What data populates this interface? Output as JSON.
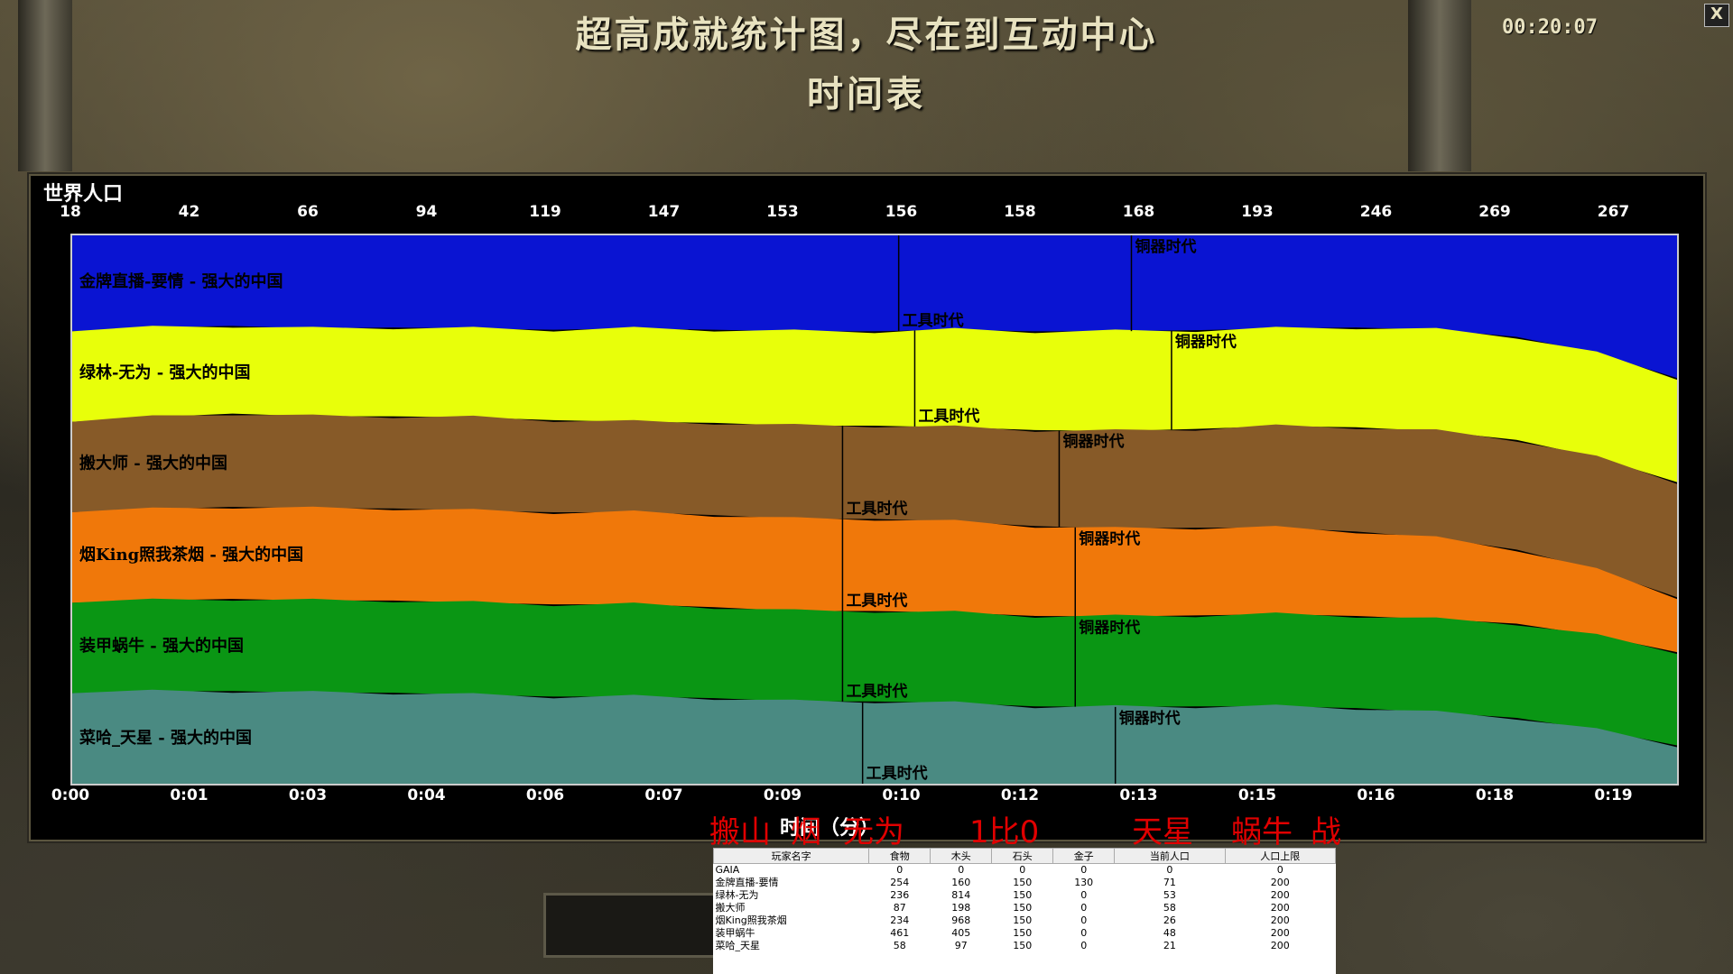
{
  "header": {
    "title": "超高成就统计图，尽在到互动中心",
    "subtitle": "时间表",
    "clock": "00:20:07",
    "close_label": "X"
  },
  "chart_panel": {
    "label": "世界人口",
    "x_axis_title": "时间（分）",
    "top_ticks": [
      "18",
      "42",
      "66",
      "94",
      "119",
      "147",
      "153",
      "156",
      "158",
      "168",
      "193",
      "246",
      "269",
      "267"
    ],
    "bottom_ticks": [
      "0:00",
      "0:01",
      "0:03",
      "0:04",
      "0:06",
      "0:07",
      "0:09",
      "0:10",
      "0:12",
      "0:13",
      "0:15",
      "0:16",
      "0:18",
      "0:19"
    ]
  },
  "chart_data": {
    "type": "area",
    "stacked": true,
    "normalized": true,
    "x_label": "时间（分）",
    "x_ticks": [
      "0:00",
      "0:01",
      "0:03",
      "0:04",
      "0:06",
      "0:07",
      "0:09",
      "0:10",
      "0:12",
      "0:13",
      "0:15",
      "0:16",
      "0:18",
      "0:19"
    ],
    "total_population_ticks": [
      18,
      42,
      66,
      94,
      119,
      147,
      153,
      156,
      158,
      168,
      193,
      246,
      269,
      267
    ],
    "x_minutes": [
      0,
      1,
      2,
      3,
      4,
      5,
      6,
      7,
      8,
      9,
      10,
      11,
      12,
      13,
      14,
      15,
      16,
      17,
      18,
      19,
      20
    ],
    "series": [
      {
        "name": "金牌直播-要情 - 强大的中国",
        "color": "#0a14d2",
        "share": [
          0.175,
          0.17,
          0.165,
          0.17,
          0.168,
          0.17,
          0.172,
          0.17,
          0.172,
          0.175,
          0.175,
          0.172,
          0.175,
          0.175,
          0.173,
          0.17,
          0.168,
          0.172,
          0.185,
          0.215,
          0.26
        ]
      },
      {
        "name": "绿林-无为 - 强大的中国",
        "color": "#e8ff0a",
        "share": [
          0.165,
          0.165,
          0.16,
          0.16,
          0.162,
          0.162,
          0.165,
          0.17,
          0.17,
          0.172,
          0.172,
          0.178,
          0.18,
          0.182,
          0.18,
          0.178,
          0.182,
          0.185,
          0.188,
          0.19,
          0.19
        ]
      },
      {
        "name": "搬大师 - 强大的中国",
        "color": "#875a28",
        "share": [
          0.165,
          0.17,
          0.17,
          0.168,
          0.168,
          0.17,
          0.168,
          0.165,
          0.168,
          0.17,
          0.17,
          0.172,
          0.175,
          0.178,
          0.18,
          0.185,
          0.19,
          0.195,
          0.2,
          0.205,
          0.21
        ]
      },
      {
        "name": "烟King照我茶烟 - 强大的中国",
        "color": "#f0780a",
        "share": [
          0.165,
          0.168,
          0.168,
          0.168,
          0.168,
          0.168,
          0.168,
          0.168,
          0.168,
          0.168,
          0.168,
          0.166,
          0.164,
          0.16,
          0.16,
          0.158,
          0.154,
          0.148,
          0.135,
          0.12,
          0.1
        ]
      },
      {
        "name": "装甲蜗牛 - 强大的中国",
        "color": "#0a9614",
        "share": [
          0.165,
          0.168,
          0.168,
          0.168,
          0.168,
          0.168,
          0.168,
          0.168,
          0.166,
          0.165,
          0.165,
          0.165,
          0.165,
          0.165,
          0.166,
          0.168,
          0.168,
          0.17,
          0.172,
          0.172,
          0.17
        ]
      },
      {
        "name": "菜哈_天星 - 强大的中国",
        "color": "#4a8a82",
        "share": [
          0.165,
          0.17,
          0.169,
          0.166,
          0.166,
          0.162,
          0.159,
          0.159,
          0.156,
          0.15,
          0.15,
          0.147,
          0.141,
          0.14,
          0.141,
          0.141,
          0.138,
          0.13,
          0.12,
          0.098,
          0.07
        ]
      }
    ],
    "age_markers": [
      {
        "series": "金牌直播-要情 - 强大的中国",
        "label": "工具时代",
        "minute": 10.3
      },
      {
        "series": "金牌直播-要情 - 强大的中国",
        "label": "铜器时代",
        "minute": 13.2
      },
      {
        "series": "绿林-无为 - 强大的中国",
        "label": "工具时代",
        "minute": 10.5
      },
      {
        "series": "绿林-无为 - 强大的中国",
        "label": "铜器时代",
        "minute": 13.7
      },
      {
        "series": "搬大师 - 强大的中国",
        "label": "工具时代",
        "minute": 9.6
      },
      {
        "series": "搬大师 - 强大的中国",
        "label": "铜器时代",
        "minute": 12.3
      },
      {
        "series": "烟King照我茶烟 - 强大的中国",
        "label": "工具时代",
        "minute": 9.6
      },
      {
        "series": "烟King照我茶烟 - 强大的中国",
        "label": "铜器时代",
        "minute": 12.5
      },
      {
        "series": "装甲蜗牛 - 强大的中国",
        "label": "工具时代",
        "minute": 9.6
      },
      {
        "series": "装甲蜗牛 - 强大的中国",
        "label": "铜器时代",
        "minute": 12.5
      },
      {
        "series": "菜哈_天星 - 强大的中国",
        "label": "工具时代",
        "minute": 9.85
      },
      {
        "series": "菜哈_天星 - 强大的中国",
        "label": "铜器时代",
        "minute": 13.0
      }
    ]
  },
  "overlay_text": [
    "搬山",
    "烟",
    "无为",
    "1比0",
    "天星",
    "蜗牛",
    "战"
  ],
  "stats_table": {
    "headers": [
      "玩家名字",
      "食物",
      "木头",
      "石头",
      "金子",
      "当前人口",
      "人口上限"
    ],
    "rows": [
      [
        "GAIA",
        "0",
        "0",
        "0",
        "0",
        "0",
        "0"
      ],
      [
        "金牌直播-要情",
        "254",
        "160",
        "150",
        "130",
        "71",
        "200"
      ],
      [
        "绿林-无为",
        "236",
        "814",
        "150",
        "0",
        "53",
        "200"
      ],
      [
        "搬大师",
        "87",
        "198",
        "150",
        "0",
        "58",
        "200"
      ],
      [
        "烟King照我茶烟",
        "234",
        "968",
        "150",
        "0",
        "26",
        "200"
      ],
      [
        "装甲蜗牛",
        "461",
        "405",
        "150",
        "0",
        "48",
        "200"
      ],
      [
        "菜哈_天星",
        "58",
        "97",
        "150",
        "0",
        "21",
        "200"
      ]
    ]
  },
  "colors": {
    "title": "#e8e2c0",
    "overlay": "#e00000",
    "panel_bg": "#000000"
  }
}
